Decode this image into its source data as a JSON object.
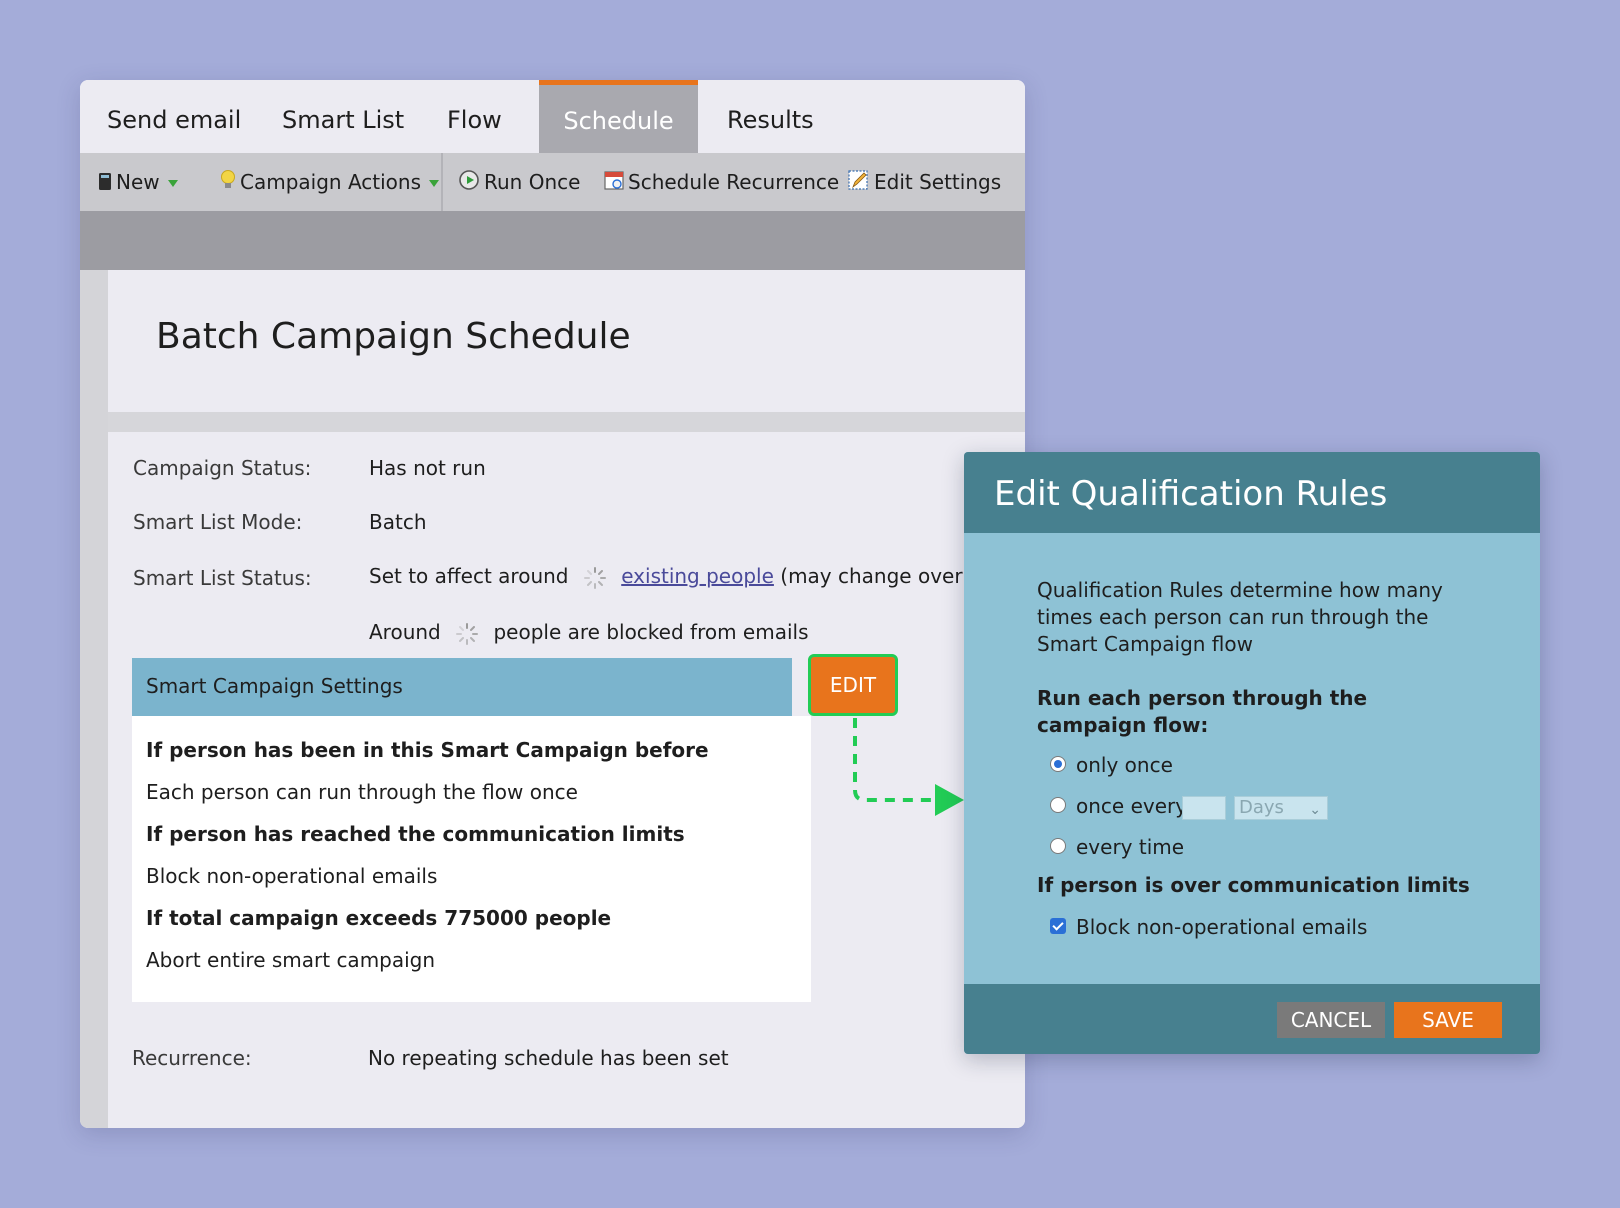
{
  "tabs": [
    {
      "label": "Send email"
    },
    {
      "label": "Smart List"
    },
    {
      "label": "Flow"
    },
    {
      "label": "Schedule",
      "active": true
    },
    {
      "label": "Results"
    }
  ],
  "toolbar": {
    "new_label": "New",
    "campaign_actions_label": "Campaign Actions",
    "run_once_label": "Run Once",
    "schedule_recurrence_label": "Schedule Recurrence",
    "edit_settings_label": "Edit Settings"
  },
  "page": {
    "title": "Batch Campaign Schedule"
  },
  "status": {
    "campaign_status_label": "Campaign Status:",
    "campaign_status_value": "Has not run",
    "smart_list_mode_label": "Smart List Mode:",
    "smart_list_mode_value": "Batch",
    "smart_list_status_label": "Smart List Status:",
    "smart_list_status_prefix": "Set to affect around",
    "smart_list_status_link": "existing people",
    "smart_list_status_suffix": "(may change over tim",
    "blocked_prefix": "Around",
    "blocked_suffix": "people are blocked from emails",
    "recurrence_label": "Recurrence:",
    "recurrence_value": "No repeating schedule has been set"
  },
  "settings": {
    "title": "Smart Campaign Settings",
    "edit_label": "EDIT",
    "lines": [
      {
        "text": "If person has been in this Smart Campaign before",
        "bold": true
      },
      {
        "text": "Each person can run through the flow once",
        "bold": false
      },
      {
        "text": "If person has reached the communication limits",
        "bold": true
      },
      {
        "text": "Block non-operational emails",
        "bold": false
      },
      {
        "text": "If total campaign exceeds 775000 people",
        "bold": true
      },
      {
        "text": "Abort entire smart campaign",
        "bold": false
      }
    ]
  },
  "dialog": {
    "title": "Edit Qualification Rules",
    "description": "Qualification Rules determine how many times each person can run through the Smart Campaign flow",
    "run_heading": "Run each person through the campaign flow:",
    "options": [
      {
        "label": "only once",
        "selected": true
      },
      {
        "label": "once every",
        "selected": false
      },
      {
        "label": "every time",
        "selected": false
      }
    ],
    "interval_value": "",
    "interval_unit": "Days",
    "limits_heading": "If person is over communication limits",
    "block_label": "Block non-operational emails",
    "block_checked": true,
    "cancel_label": "CANCEL",
    "save_label": "SAVE"
  },
  "colors": {
    "accent_orange": "#e8741c",
    "highlight_green": "#22cc55",
    "dialog_header": "#47808f",
    "dialog_body": "#8ec2d5"
  }
}
